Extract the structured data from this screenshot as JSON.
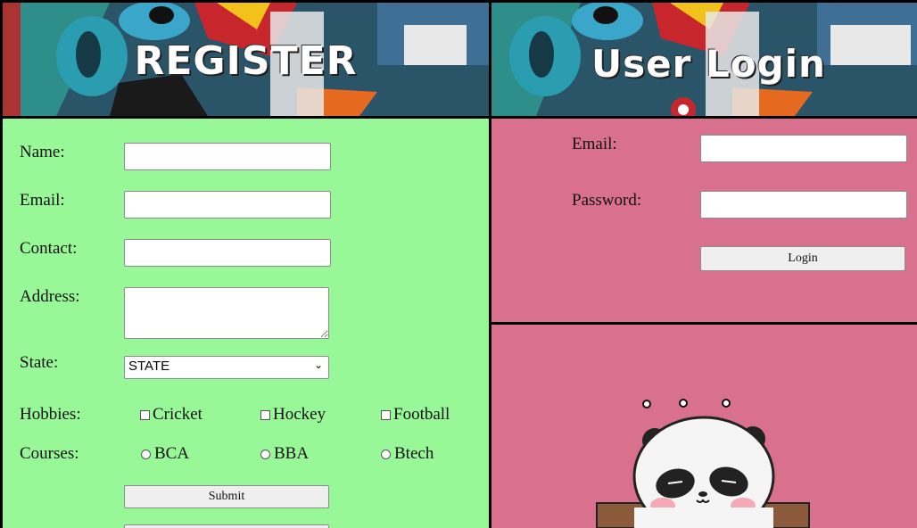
{
  "register": {
    "title": "REGISTER",
    "labels": {
      "name": "Name:",
      "email": "Email:",
      "contact": "Contact:",
      "address": "Address:",
      "state": "State:",
      "hobbies": "Hobbies:",
      "courses": "Courses:"
    },
    "inputs": {
      "name": "",
      "email": "",
      "contact": "",
      "address": ""
    },
    "state_selected": "STATE",
    "hobbies": [
      "Cricket",
      "Hockey",
      "Football"
    ],
    "courses": [
      "BCA",
      "BBA",
      "Btech"
    ],
    "submit_label": "Submit"
  },
  "login": {
    "title": "User Login",
    "labels": {
      "email": "Email:",
      "password": "Password:"
    },
    "inputs": {
      "email": "",
      "password": ""
    },
    "login_label": "Login"
  },
  "colors": {
    "register_bg": "#98f898",
    "login_bg": "#d9718e"
  },
  "icons": {
    "hobby_checkbox": "checkbox",
    "course_radio": "radio-button",
    "select_chevron": "chevron-down-icon"
  }
}
